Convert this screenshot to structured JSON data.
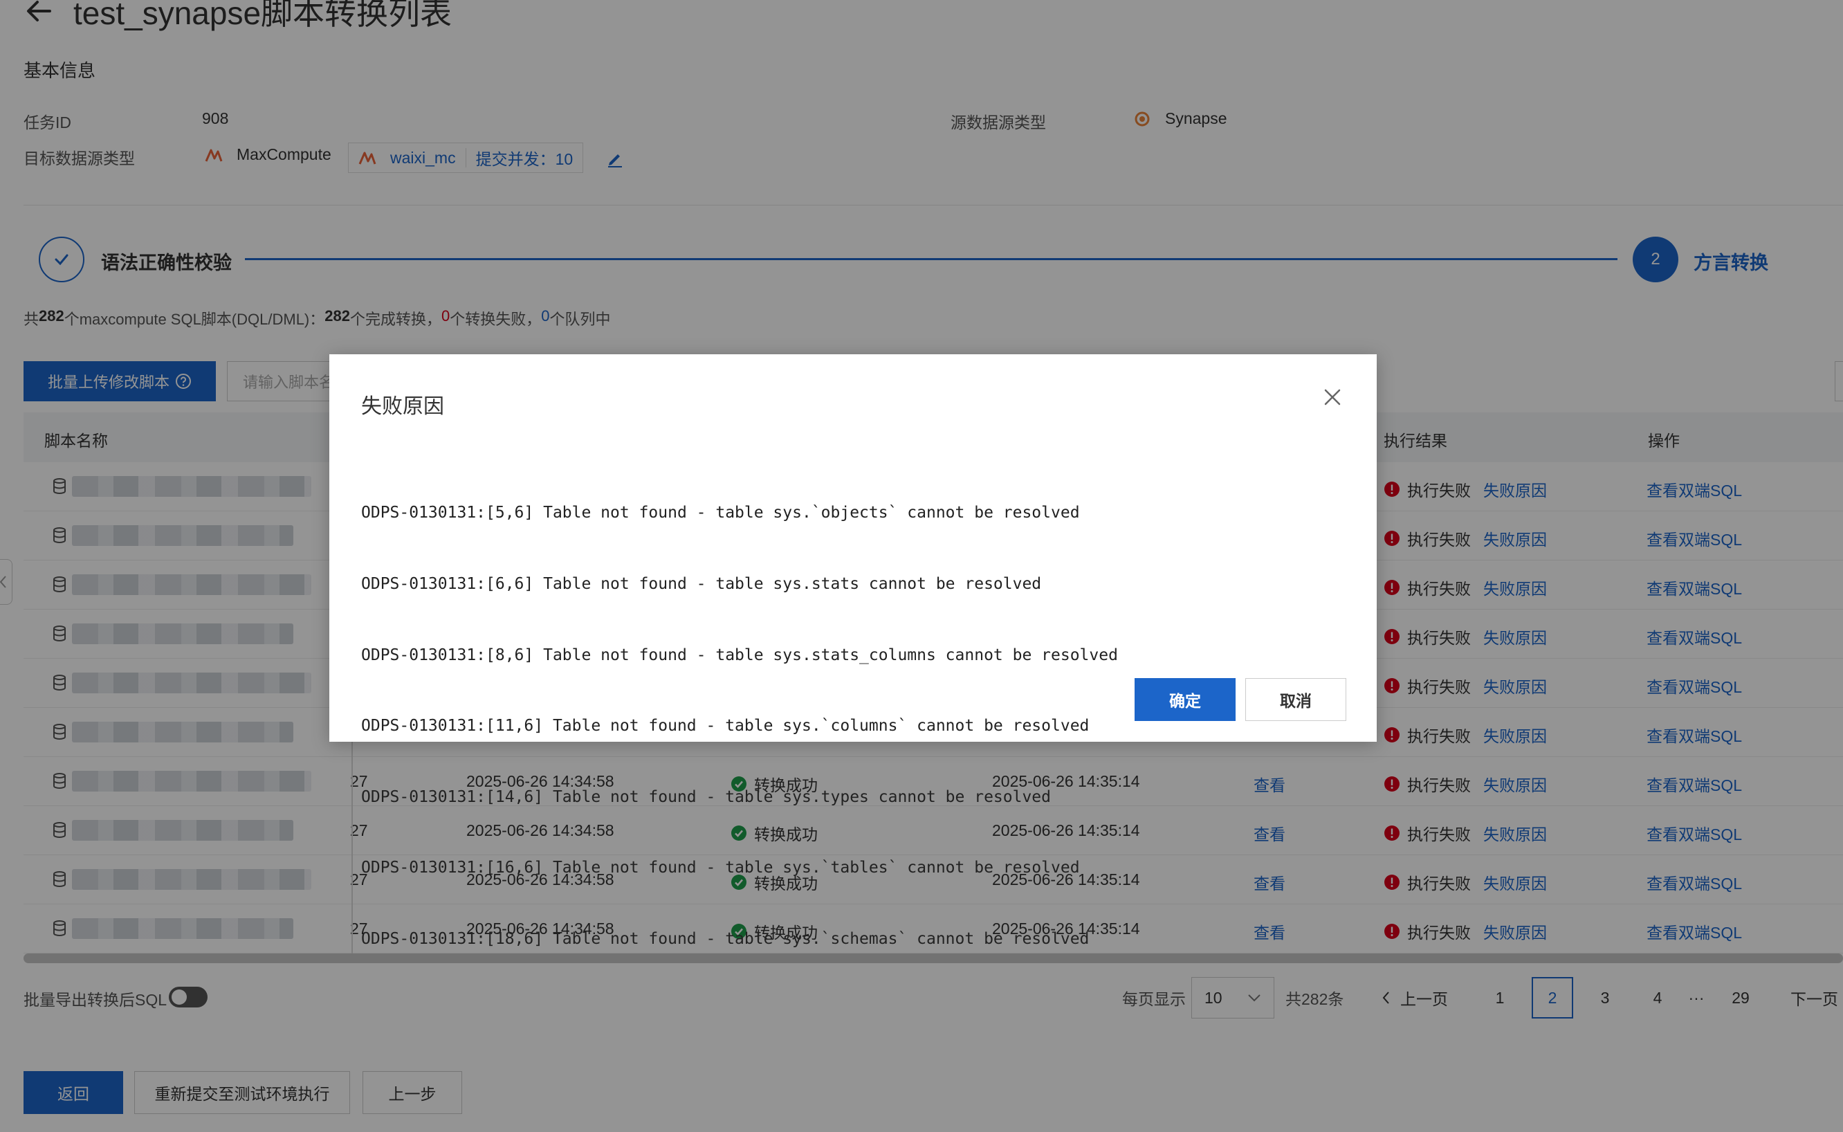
{
  "header": {
    "title": "test_synapse脚本转换列表"
  },
  "basic_info": {
    "section_title": "基本信息",
    "task_id_label": "任务ID",
    "task_id": "908",
    "source_type_label": "源数据源类型",
    "source_type": "Synapse",
    "target_type_label": "目标数据源类型",
    "target_type": "MaxCompute",
    "connection_name": "waixi_mc",
    "concurrency": "提交并发：10"
  },
  "steps": {
    "step1_label": "语法正确性校验",
    "step2_number": "2",
    "step2_label": "方言转换"
  },
  "summary": {
    "p1": "共",
    "total": "282",
    "p2": "个maxcompute SQL脚本(DQL/DML)：",
    "done": "282",
    "p3": "个完成转换，",
    "failed": "0",
    "p4": "个转换失败，",
    "queued": "0",
    "p5": "个队列中"
  },
  "toolbar": {
    "upload_label": "批量上传修改脚本",
    "search_placeholder": "请输入脚本名"
  },
  "table": {
    "columns": {
      "name": "脚本名称",
      "exec_result": "执行结果",
      "actions": "操作"
    },
    "rows": [
      {
        "c1": "",
        "start": "",
        "status": "",
        "end": "",
        "view": "",
        "exec": "执行失败",
        "reason": "失败原因",
        "action": "查看双端SQL"
      },
      {
        "c1": "",
        "start": "",
        "status": "",
        "end": "",
        "view": "",
        "exec": "执行失败",
        "reason": "失败原因",
        "action": "查看双端SQL"
      },
      {
        "c1": "",
        "start": "",
        "status": "",
        "end": "",
        "view": "",
        "exec": "执行失败",
        "reason": "失败原因",
        "action": "查看双端SQL"
      },
      {
        "c1": "",
        "start": "",
        "status": "",
        "end": "",
        "view": "",
        "exec": "执行失败",
        "reason": "失败原因",
        "action": "查看双端SQL"
      },
      {
        "c1": "",
        "start": "",
        "status": "",
        "end": "",
        "view": "",
        "exec": "执行失败",
        "reason": "失败原因",
        "action": "查看双端SQL"
      },
      {
        "c1": "",
        "start": "",
        "status": "",
        "end": "",
        "view": "",
        "exec": "执行失败",
        "reason": "失败原因",
        "action": "查看双端SQL"
      },
      {
        "c1": "27",
        "start": "2025-06-26 14:34:58",
        "status": "转换成功",
        "end": "2025-06-26 14:35:14",
        "view": "查看",
        "exec": "执行失败",
        "reason": "失败原因",
        "action": "查看双端SQL"
      },
      {
        "c1": "27",
        "start": "2025-06-26 14:34:58",
        "status": "转换成功",
        "end": "2025-06-26 14:35:14",
        "view": "查看",
        "exec": "执行失败",
        "reason": "失败原因",
        "action": "查看双端SQL"
      },
      {
        "c1": "27",
        "start": "2025-06-26 14:34:58",
        "status": "转换成功",
        "end": "2025-06-26 14:35:14",
        "view": "查看",
        "exec": "执行失败",
        "reason": "失败原因",
        "action": "查看双端SQL"
      },
      {
        "c1": "27",
        "start": "2025-06-26 14:34:58",
        "status": "转换成功",
        "end": "2025-06-26 14:35:14",
        "view": "查看",
        "exec": "执行失败",
        "reason": "失败原因",
        "action": "查看双端SQL"
      }
    ]
  },
  "footer": {
    "export_label": "批量导出转换后SQL",
    "page_size_label": "每页显示",
    "page_size": "10",
    "total": "共282条",
    "prev": "上一页",
    "pages": [
      "1",
      "2",
      "3",
      "4"
    ],
    "ellipsis": "···",
    "last_page": "29",
    "next": "下一页",
    "back_button": "返回",
    "resubmit_button": "重新提交至测试环境执行",
    "prev_step_button": "上一步"
  },
  "modal": {
    "title": "失败原因",
    "lines": [
      "ODPS-0130131:[5,6] Table not found - table sys.`objects` cannot be resolved",
      "ODPS-0130131:[6,6] Table not found - table sys.stats cannot be resolved",
      "ODPS-0130131:[8,6] Table not found - table sys.stats_columns cannot be resolved",
      "ODPS-0130131:[11,6] Table not found - table sys.`columns` cannot be resolved",
      "ODPS-0130131:[14,6] Table not found - table sys.types cannot be resolved",
      "ODPS-0130131:[16,6] Table not found - table sys.`tables` cannot be resolved",
      "ODPS-0130131:[18,6] Table not found - table sys.`schemas` cannot be resolved"
    ],
    "ok_label": "确定",
    "cancel_label": "取消"
  },
  "colors": {
    "primary": "#1c65c9",
    "error": "#d9001b",
    "success": "#1e9e4a"
  }
}
